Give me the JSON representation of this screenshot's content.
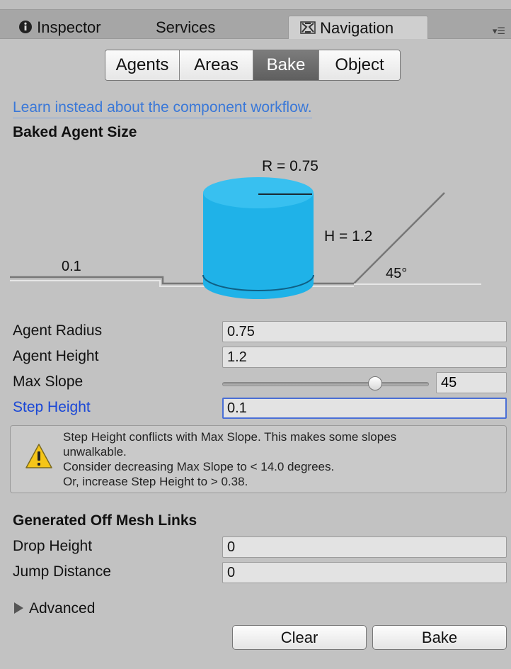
{
  "tabs": [
    {
      "label": "Inspector",
      "icon": "info-icon"
    },
    {
      "label": "Services",
      "icon": ""
    },
    {
      "label": "Navigation",
      "icon": "navigation-icon"
    }
  ],
  "segments": [
    "Agents",
    "Areas",
    "Bake",
    "Object"
  ],
  "selected_segment": "Bake",
  "link_text": "Learn instead about the component workflow.",
  "baked_agent_size": {
    "title": "Baked Agent Size",
    "radius_label": "R = 0.75",
    "height_label": "H = 1.2",
    "step_label": "0.1",
    "slope_label": "45°"
  },
  "fields": {
    "agent_radius": {
      "label": "Agent Radius",
      "value": "0.75"
    },
    "agent_height": {
      "label": "Agent Height",
      "value": "1.2"
    },
    "max_slope": {
      "label": "Max Slope",
      "value": "45",
      "fraction": 0.74
    },
    "step_height": {
      "label": "Step Height",
      "value": "0.1"
    }
  },
  "warning": {
    "lines": [
      "Step Height conflicts with Max Slope. This makes some slopes",
      "unwalkable.",
      "Consider decreasing Max Slope to < 14.0 degrees.",
      "Or, increase Step Height to > 0.38."
    ]
  },
  "off_mesh": {
    "title": "Generated Off Mesh Links",
    "drop_height": {
      "label": "Drop Height",
      "value": "0"
    },
    "jump_distance": {
      "label": "Jump Distance",
      "value": "0"
    }
  },
  "advanced_label": "Advanced",
  "buttons": {
    "clear": "Clear",
    "bake": "Bake"
  },
  "colors": {
    "agent": "#1fb2e8",
    "link": "#3a78d8",
    "focus": "#4a6fd6"
  }
}
